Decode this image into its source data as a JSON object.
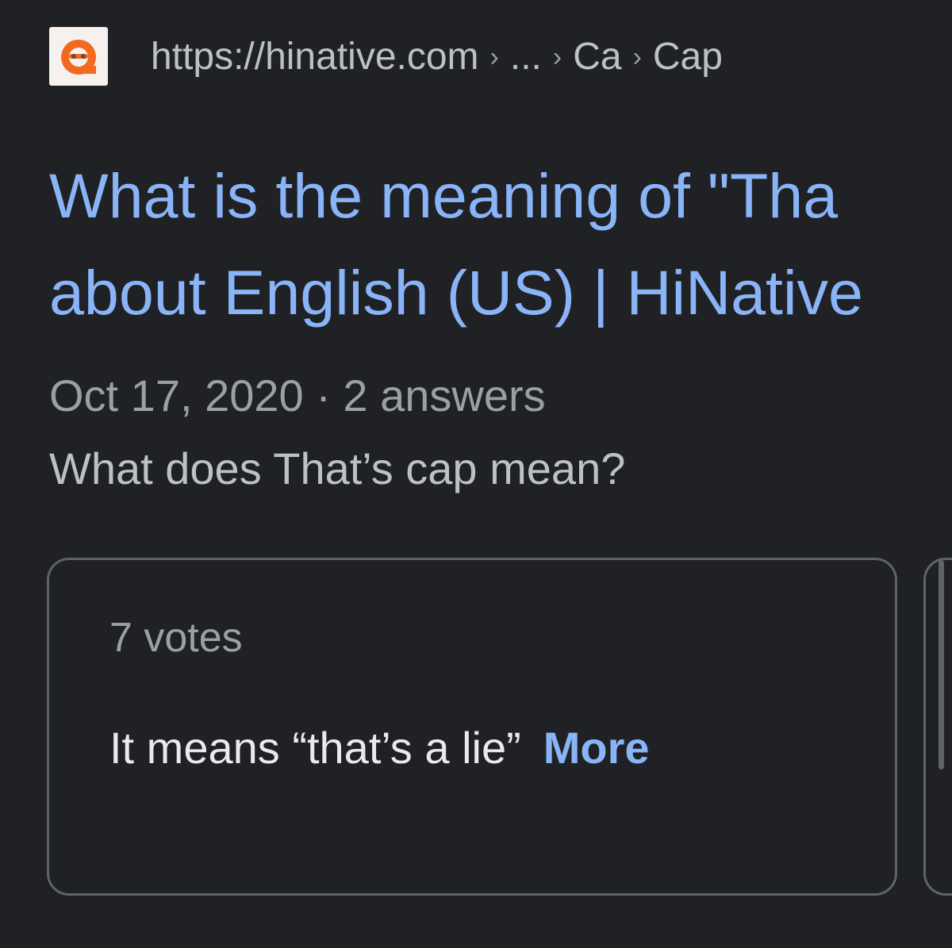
{
  "result": {
    "favicon": "hinative-logo-icon",
    "url": {
      "domain": "https://hinative.com",
      "sep": "›",
      "ellipsis": "...",
      "crumb1": "Ca",
      "crumb2": "Cap"
    },
    "title_line1": "What is the meaning of \"Tha",
    "title_line2": "about English (US) | HiNative",
    "meta": "Oct 17, 2020 · 2 answers",
    "snippet": "What does That’s cap mean?"
  },
  "answer_card": {
    "votes": "7 votes",
    "text": "It means “that’s a lie”",
    "more": "More"
  },
  "colors": {
    "background": "#202124",
    "link": "#8ab4f8",
    "muted": "#9aa0a6",
    "text": "#bdc1c6",
    "favicon_orange": "#f2691f"
  }
}
